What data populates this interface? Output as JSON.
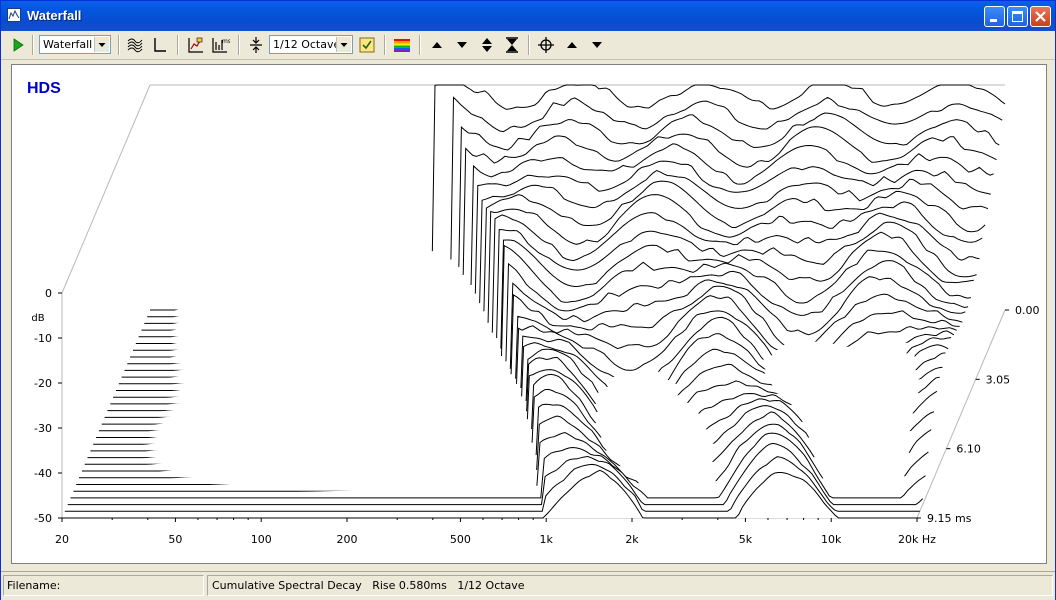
{
  "window": {
    "title": "Waterfall"
  },
  "toolbar": {
    "view_mode": "Waterfall",
    "smoothing": "1/12 Octave"
  },
  "status": {
    "filename_label": "Filename:",
    "info": "Cumulative Spectral Decay   Rise 0.580ms   1/12 Octave"
  },
  "chart_data": {
    "type": "waterfall",
    "title": "HDS",
    "ylabel": "dB",
    "x_scale": "log",
    "xlim": [
      20,
      20000
    ],
    "ylim": [
      -50,
      0
    ],
    "zlim": [
      0,
      9.15
    ],
    "x_ticks": [
      "20",
      "50",
      "100",
      "200",
      "500",
      "1k",
      "2k",
      "5k",
      "10k",
      "20k Hz"
    ],
    "x_tick_values": [
      20,
      50,
      100,
      200,
      500,
      1000,
      2000,
      5000,
      10000,
      20000
    ],
    "y_ticks": [
      "0",
      "-10",
      "-20",
      "-30",
      "-40",
      "-50"
    ],
    "y_tick_values": [
      0,
      -10,
      -20,
      -30,
      -40,
      -50
    ],
    "time_ticks": [
      "0.00",
      "3.05",
      "6.10",
      "9.15 ms"
    ],
    "time_tick_values": [
      0,
      3.05,
      6.1,
      9.15
    ],
    "num_slices": 32,
    "title_color": "#0000cc"
  }
}
